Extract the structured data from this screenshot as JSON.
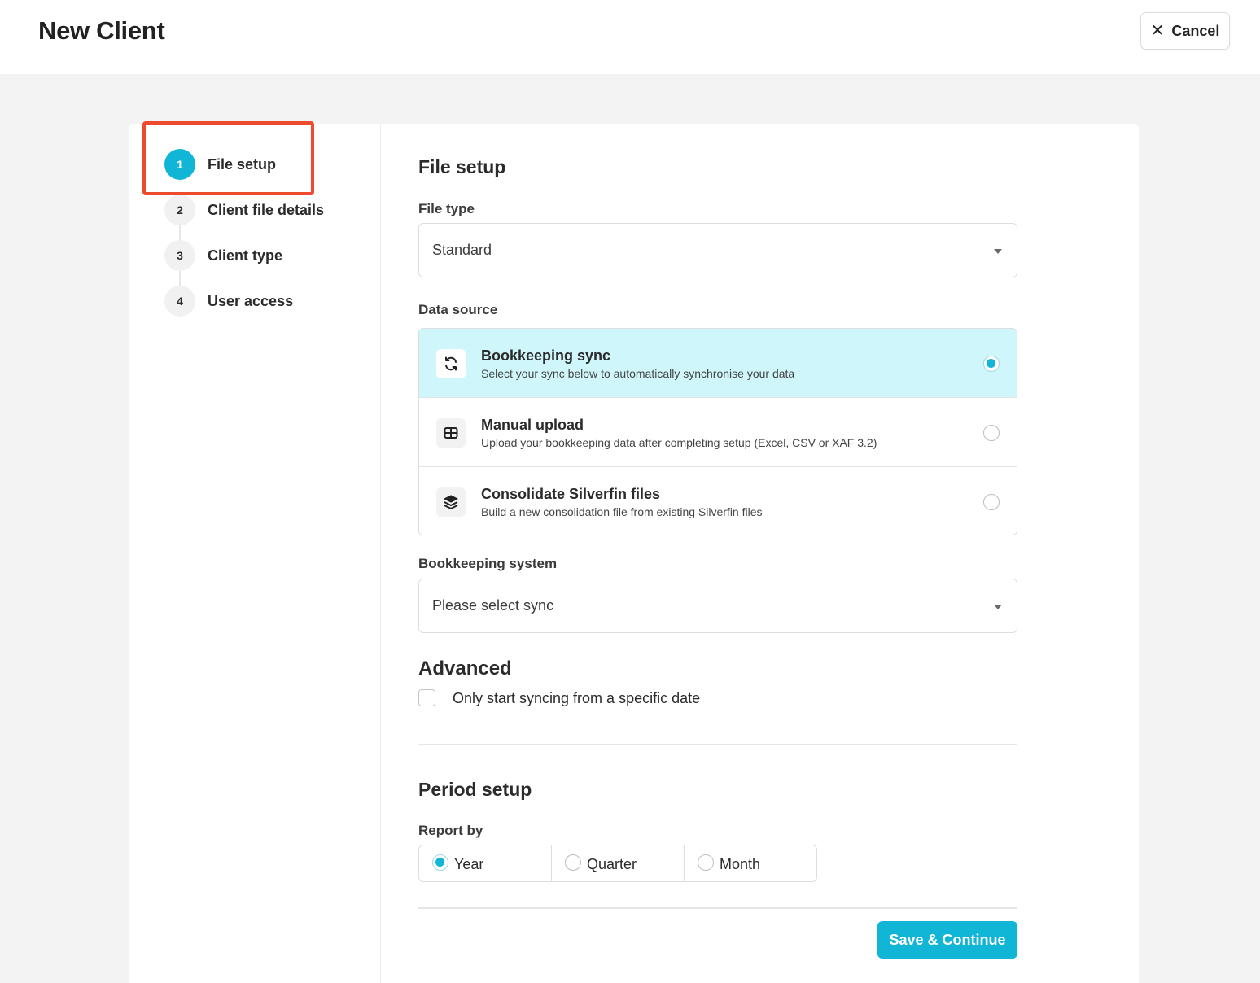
{
  "header": {
    "title": "New Client",
    "cancel_label": "Cancel"
  },
  "steps": [
    {
      "number": "1",
      "label": "File setup",
      "active": true
    },
    {
      "number": "2",
      "label": "Client file details",
      "active": false
    },
    {
      "number": "3",
      "label": "Client type",
      "active": false
    },
    {
      "number": "4",
      "label": "User access",
      "active": false
    }
  ],
  "file_setup": {
    "heading": "File setup",
    "file_type_label": "File type",
    "file_type_value": "Standard",
    "data_source_label": "Data source",
    "data_sources": [
      {
        "title": "Bookkeeping sync",
        "description": "Select your sync below to automatically synchronise your data",
        "icon": "sync-icon",
        "selected": true
      },
      {
        "title": "Manual upload",
        "description": "Upload your bookkeeping data after completing setup (Excel, CSV or XAF 3.2)",
        "icon": "table-icon",
        "selected": false
      },
      {
        "title": "Consolidate Silverfin files",
        "description": "Build a new consolidation file from existing Silverfin files",
        "icon": "layers-icon",
        "selected": false
      }
    ],
    "bookkeeping_system_label": "Bookkeeping system",
    "bookkeeping_system_value": "Please select sync"
  },
  "advanced": {
    "heading": "Advanced",
    "sync_date_label": "Only start syncing from a specific date",
    "sync_date_checked": false
  },
  "period_setup": {
    "heading": "Period setup",
    "report_by_label": "Report by",
    "options": [
      {
        "label": "Year",
        "selected": true
      },
      {
        "label": "Quarter",
        "selected": false
      },
      {
        "label": "Month",
        "selected": false
      }
    ]
  },
  "footer": {
    "save_label": "Save & Continue"
  },
  "colors": {
    "accent": "#11b5d6",
    "selected_bg": "#cff7fb",
    "highlight": "#ee4a2d"
  }
}
